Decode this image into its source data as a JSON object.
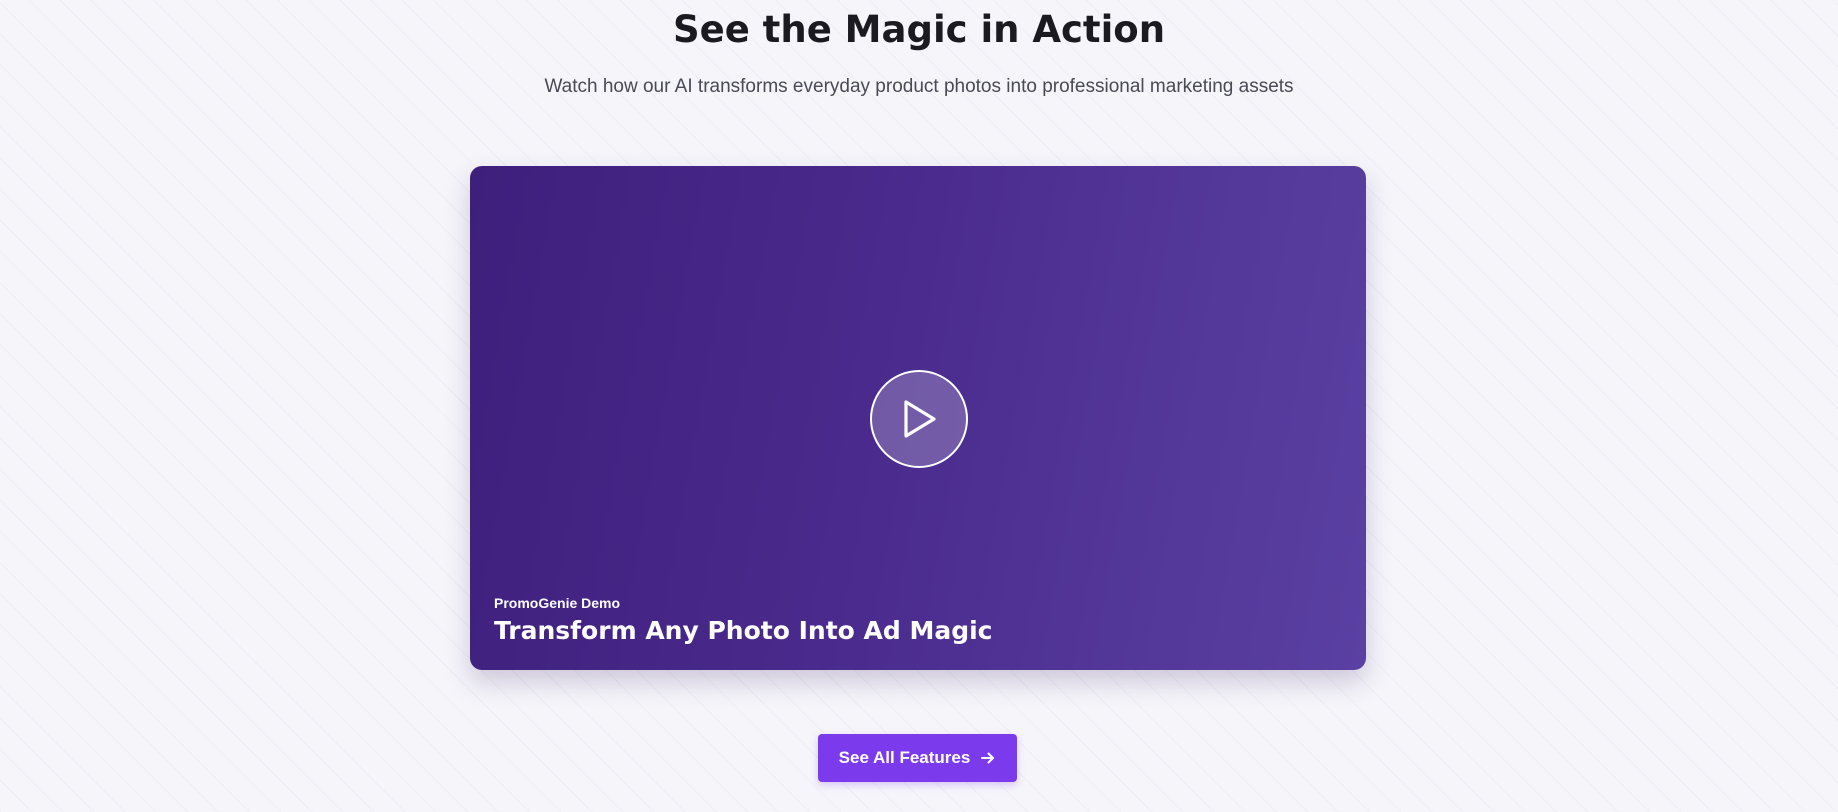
{
  "header": {
    "title": "See the Magic in Action",
    "subtitle": "Watch how our AI transforms everyday product photos into professional marketing assets"
  },
  "video": {
    "eyebrow": "PromoGenie Demo",
    "heading": "Transform Any Photo Into Ad Magic",
    "play_icon": "play-icon",
    "gradient_start": "#3e1f7c",
    "gradient_end": "#5a40a2"
  },
  "cta": {
    "label": "See All Features",
    "icon": "arrow-right-icon",
    "color": "#7c3aed"
  }
}
